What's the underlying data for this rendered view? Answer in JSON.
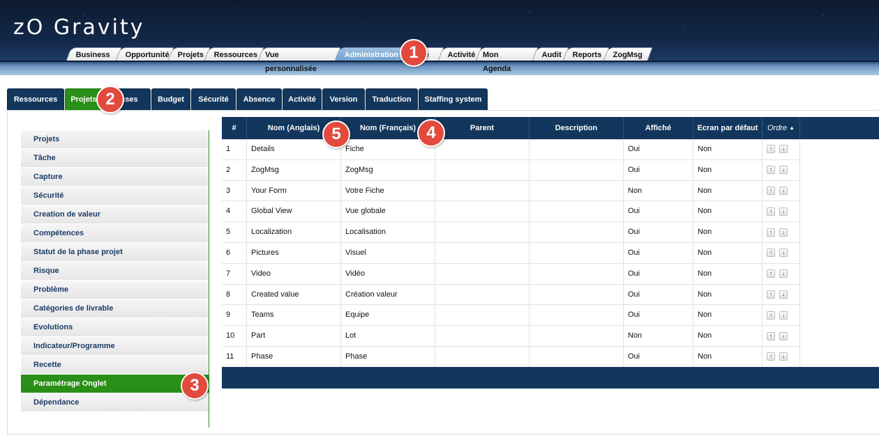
{
  "app": {
    "logo_main": "zO",
    "logo_rest": "Gravity",
    "logo_display": "zO Gravity"
  },
  "top_tabs": [
    {
      "label": "Business"
    },
    {
      "label": "Opportunité"
    },
    {
      "label": "Projets"
    },
    {
      "label": "Ressources"
    },
    {
      "label": "Vue personnalisée"
    },
    {
      "label": "Administration",
      "active": true
    },
    {
      "label": "ence"
    },
    {
      "label": "Activité"
    },
    {
      "label": "Mon Agenda"
    },
    {
      "label": "Audit"
    },
    {
      "label": "Reports"
    },
    {
      "label": "ZogMsg"
    }
  ],
  "sub_tabs": [
    {
      "label": "Ressources"
    },
    {
      "label": "Projets",
      "active": true
    },
    {
      "label": "enses"
    },
    {
      "label": "Budget"
    },
    {
      "label": "Sécurité"
    },
    {
      "label": "Absence"
    },
    {
      "label": "Activité"
    },
    {
      "label": "Version"
    },
    {
      "label": "Traduction"
    },
    {
      "label": "Staffing system"
    }
  ],
  "side_menu": [
    {
      "label": "Projets"
    },
    {
      "label": "Tâche"
    },
    {
      "label": "Capture"
    },
    {
      "label": "Sécurité"
    },
    {
      "label": "Creation de valeur"
    },
    {
      "label": "Compétences"
    },
    {
      "label": "Statut de la phase projet"
    },
    {
      "label": "Risque"
    },
    {
      "label": "Problème"
    },
    {
      "label": "Catégories de livrable"
    },
    {
      "label": "Evolutions"
    },
    {
      "label": "Indicateur/Programme"
    },
    {
      "label": "Recette"
    },
    {
      "label": "Paramétrage Onglet",
      "active": true
    },
    {
      "label": "Dépendance"
    }
  ],
  "table": {
    "headers": [
      "#",
      "Nom (Anglais)",
      "Nom (Français)",
      "Parent",
      "Description",
      "Affiché",
      "Ecran par défaut",
      "Ordre"
    ],
    "rows": [
      [
        "1",
        "Details",
        "Fiche",
        "",
        "",
        "Oui",
        "Non"
      ],
      [
        "2",
        "ZogMsg",
        "ZogMsg",
        "",
        "",
        "Oui",
        "Non"
      ],
      [
        "3",
        "Your Form",
        "Votre Fiche",
        "",
        "",
        "Non",
        "Non"
      ],
      [
        "4",
        "Global View",
        "Vue globale",
        "",
        "",
        "Oui",
        "Non"
      ],
      [
        "5",
        "Localization",
        "Localisation",
        "",
        "",
        "Oui",
        "Non"
      ],
      [
        "6",
        "Pictures",
        "Visuel",
        "",
        "",
        "Oui",
        "Non"
      ],
      [
        "7",
        "Video",
        "Vidéo",
        "",
        "",
        "Oui",
        "Non"
      ],
      [
        "8",
        "Created value",
        "Création valeur",
        "",
        "",
        "Oui",
        "Non"
      ],
      [
        "9",
        "Teams",
        "Equipe",
        "",
        "",
        "Oui",
        "Non"
      ],
      [
        "10",
        "Part",
        "Lot",
        "",
        "",
        "Non",
        "Non"
      ],
      [
        "11",
        "Phase",
        "Phase",
        "",
        "",
        "Oui",
        "Non"
      ]
    ]
  },
  "callouts": [
    "1",
    "2",
    "3",
    "4",
    "5"
  ],
  "colors": {
    "accent_green": "#2a8f16",
    "navy": "#12365c",
    "callout_red": "#e24a3e"
  }
}
